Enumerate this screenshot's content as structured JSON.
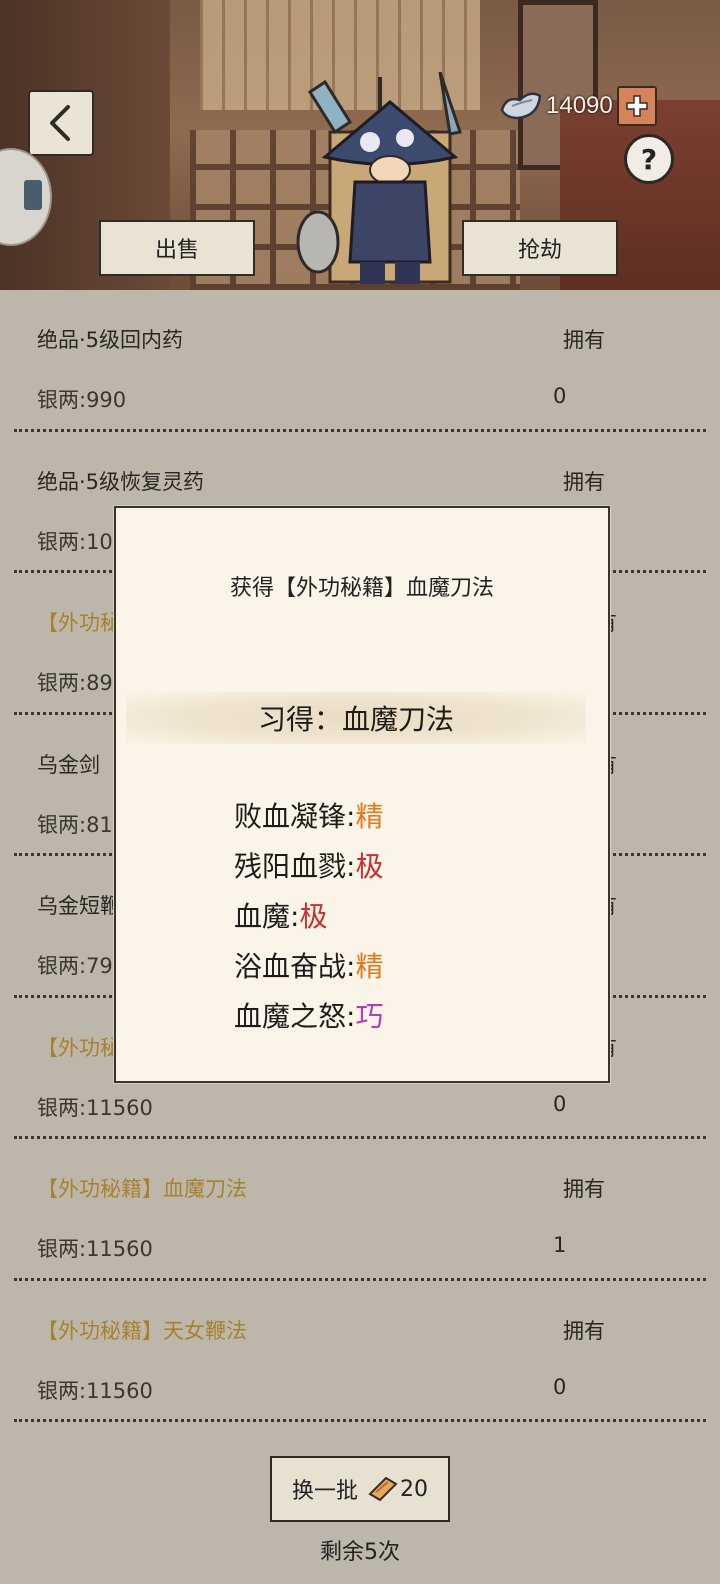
{
  "header": {
    "currency_amount": "14090",
    "sell_label": "出售",
    "rob_label": "抢劫",
    "help_label": "?"
  },
  "items": [
    {
      "name": "绝品·5级回内药",
      "own_label": "拥有",
      "price": "银两:990",
      "count": "0",
      "gold": false
    },
    {
      "name": "绝品·5级恢复灵药",
      "own_label": "拥有",
      "price": "银两:10",
      "count": "",
      "gold": false
    },
    {
      "name": "【外功秘",
      "own_label": "有",
      "price": "银两:89",
      "count": "",
      "gold": true
    },
    {
      "name": "乌金剑",
      "own_label": "有",
      "price": "银两:81",
      "count": "",
      "gold": false
    },
    {
      "name": "乌金短鞭",
      "own_label": "有",
      "price": "银两:79",
      "count": "",
      "gold": false
    },
    {
      "name": "【外功秘",
      "own_label": "有",
      "price": "银两:11560",
      "count": "0",
      "gold": true
    },
    {
      "name": "【外功秘籍】血魔刀法",
      "own_label": "拥有",
      "price": "银两:11560",
      "count": "1",
      "gold": true
    },
    {
      "name": "【外功秘籍】天女鞭法",
      "own_label": "拥有",
      "price": "银两:11560",
      "count": "0",
      "gold": true
    }
  ],
  "footer": {
    "refresh_label": "换一批",
    "refresh_cost": "20",
    "remaining": "剩余5次"
  },
  "dialog": {
    "title": "获得【外功秘籍】血魔刀法",
    "learned": "习得：血魔刀法",
    "skills": [
      {
        "name": "败血凝锋:",
        "grade": "精",
        "grade_class": "g-jing"
      },
      {
        "name": "残阳血戮:",
        "grade": "极",
        "grade_class": "g-ji"
      },
      {
        "name": "血魔:",
        "grade": "极",
        "grade_class": "g-ji"
      },
      {
        "name": "浴血奋战:",
        "grade": "精",
        "grade_class": "g-jing"
      },
      {
        "name": "血魔之怒:",
        "grade": "巧",
        "grade_class": "g-qiao"
      }
    ]
  }
}
